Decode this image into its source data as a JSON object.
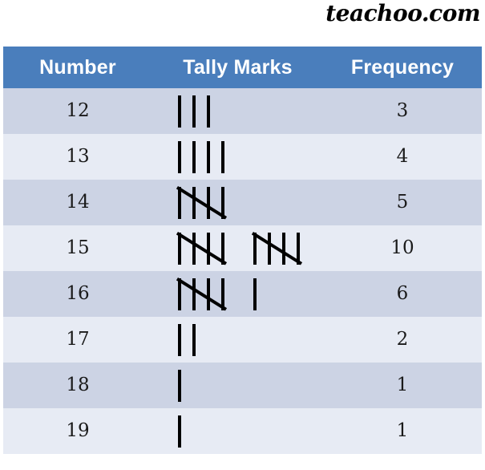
{
  "watermark": {
    "text": "teachoo.com"
  },
  "table": {
    "headers": {
      "number": "Number",
      "tally_marks": "Tally Marks",
      "frequency": "Frequency"
    },
    "colors": {
      "header_background": "#4a7ebc",
      "header_text": "#ffffff",
      "row_odd_background": "#ccd3e4",
      "row_even_background": "#e7ebf4",
      "grid_line": "#ffffff",
      "text": "#1a1a1a",
      "tally_stroke": "#000000"
    },
    "rows": [
      {
        "number": "12",
        "frequency": "3",
        "tally_groups": [
          3
        ]
      },
      {
        "number": "13",
        "frequency": "4",
        "tally_groups": [
          4
        ]
      },
      {
        "number": "14",
        "frequency": "5",
        "tally_groups": [
          5
        ]
      },
      {
        "number": "15",
        "frequency": "10",
        "tally_groups": [
          5,
          5
        ]
      },
      {
        "number": "16",
        "frequency": "6",
        "tally_groups": [
          5,
          1
        ]
      },
      {
        "number": "17",
        "frequency": "2",
        "tally_groups": [
          2
        ]
      },
      {
        "number": "18",
        "frequency": "1",
        "tally_groups": [
          1
        ]
      },
      {
        "number": "19",
        "frequency": "1",
        "tally_groups": [
          1
        ]
      }
    ]
  }
}
